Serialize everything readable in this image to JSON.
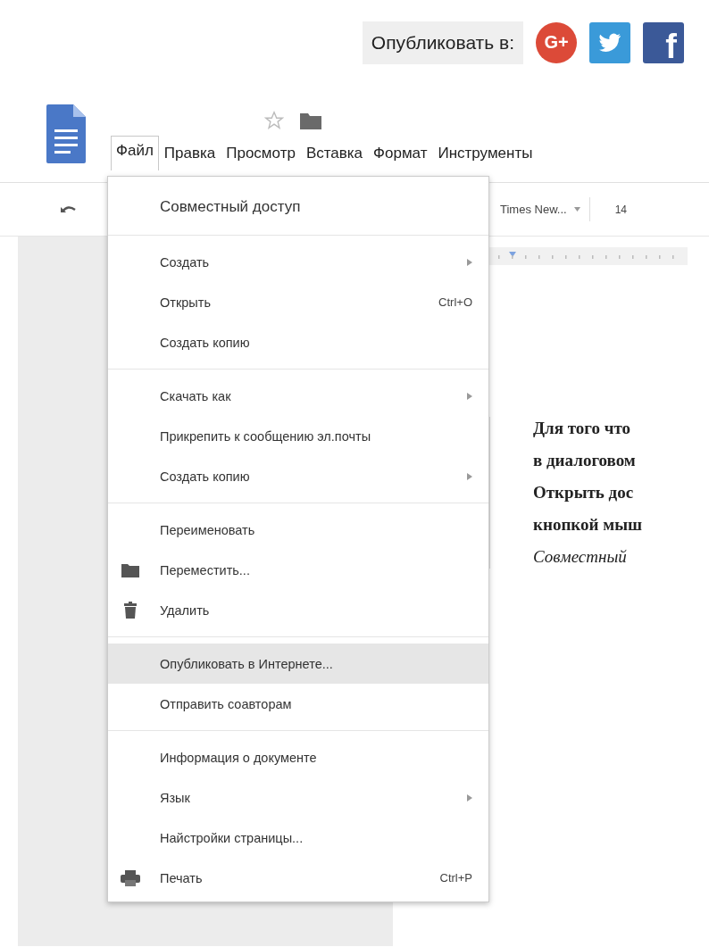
{
  "share": {
    "label": "Опубликовать в:",
    "buttons": [
      {
        "kind": "gplus",
        "label": "G+"
      },
      {
        "kind": "twitter"
      },
      {
        "kind": "facebook",
        "label": "f"
      }
    ]
  },
  "menu_bar": [
    {
      "label": "Файл",
      "selected": true
    },
    {
      "label": "Правка",
      "selected": false
    },
    {
      "label": "Просмотр",
      "selected": false
    },
    {
      "label": "Вставка",
      "selected": false
    },
    {
      "label": "Формат",
      "selected": false
    },
    {
      "label": "Инструменты",
      "selected": false
    }
  ],
  "toolbar": {
    "font": "Times New...",
    "size": "14"
  },
  "document": {
    "lines": [
      {
        "text": "Для того что",
        "italic": false
      },
      {
        "text": "в диалоговом",
        "italic": false
      },
      {
        "text": "Открыть  дос",
        "italic": false
      },
      {
        "text": "кнопкой мыш",
        "italic": false
      },
      {
        "text": "Совместный",
        "italic": true
      }
    ]
  },
  "file_menu": {
    "sections": [
      [
        {
          "kind": "primary",
          "label": "Совместный доступ",
          "selected": false
        }
      ],
      [
        {
          "kind": "item",
          "label": "Создать",
          "submenu": true,
          "selected": false
        },
        {
          "kind": "item",
          "label": "Открыть",
          "shortcut": "Ctrl+O",
          "selected": false
        },
        {
          "kind": "item",
          "label": "Создать копию",
          "selected": false
        }
      ],
      [
        {
          "kind": "item",
          "label": "Скачать как",
          "submenu": true,
          "selected": false
        },
        {
          "kind": "item",
          "label": "Прикрепить к сообщению эл.почты",
          "selected": false
        },
        {
          "kind": "item",
          "label": "Создать копию",
          "submenu": true,
          "selected": false
        }
      ],
      [
        {
          "kind": "item",
          "label": "Переименовать",
          "selected": false
        },
        {
          "kind": "folder",
          "label": "Переместить...",
          "selected": false
        },
        {
          "kind": "trash",
          "label": "Удалить",
          "selected": false
        }
      ],
      [
        {
          "kind": "item",
          "label": "Опубликовать в Интернете...",
          "selected": true
        },
        {
          "kind": "item",
          "label": "Отправить соавторам",
          "selected": false
        }
      ],
      [
        {
          "kind": "item",
          "label": "Информация о документе",
          "selected": false
        },
        {
          "kind": "item",
          "label": "Язык",
          "submenu": true,
          "selected": false
        },
        {
          "kind": "item",
          "label": "Найстройки страницы...",
          "selected": false
        },
        {
          "kind": "printer",
          "label": "Печать",
          "shortcut": "Ctrl+P",
          "selected": false
        }
      ]
    ]
  }
}
